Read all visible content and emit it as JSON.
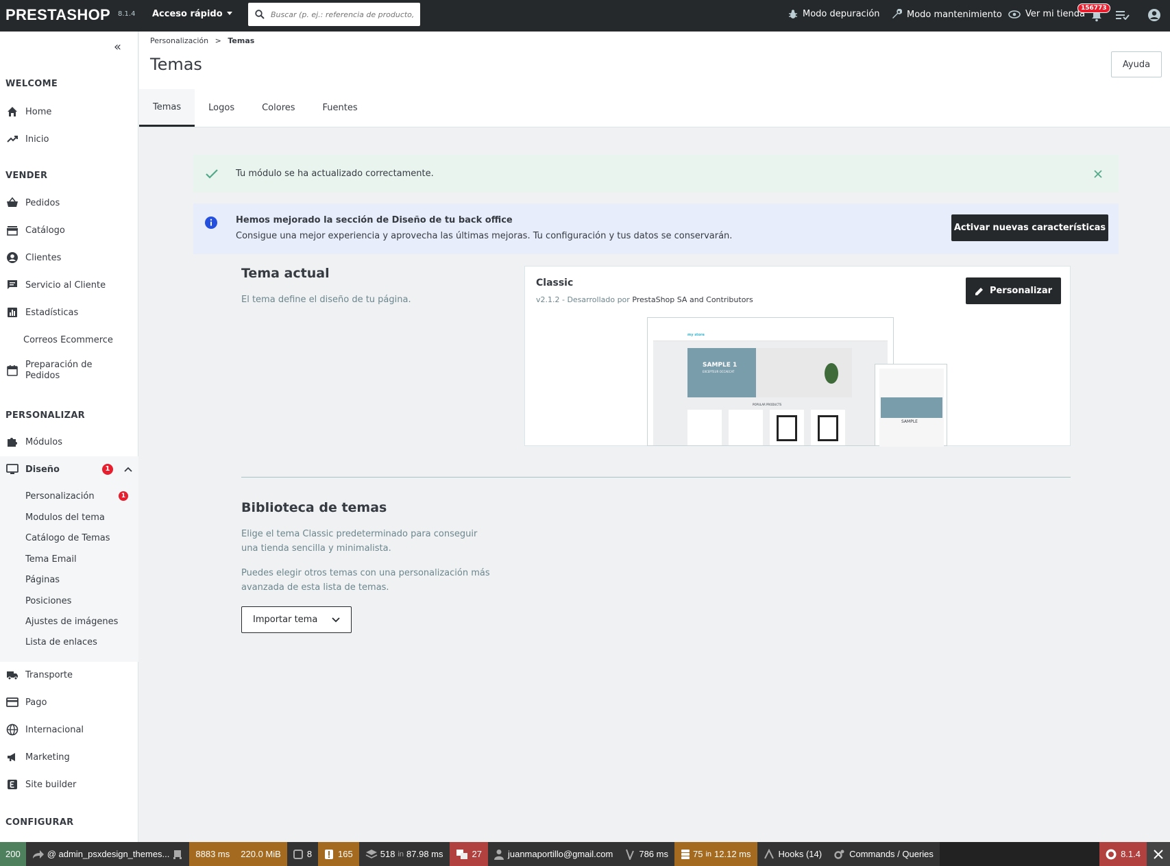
{
  "topbar": {
    "logo": "PRESTASHOP",
    "version": "8.1.4",
    "quick_access": "Acceso rápido",
    "search_placeholder": "Buscar (p. ej.: referencia de producto,",
    "debug": "Modo depuración",
    "maintenance": "Modo mantenimiento",
    "view_store": "Ver mi tienda",
    "notifications_count": "156773"
  },
  "sidebar": {
    "sections": {
      "welcome": "WELCOME",
      "sell": "VENDER",
      "customize": "PERSONALIZAR",
      "configure": "CONFIGURAR"
    },
    "welcome_items": [
      {
        "label": "Home",
        "icon": "home-icon"
      },
      {
        "label": "Inicio",
        "icon": "trending-up-icon"
      }
    ],
    "sell_items": [
      {
        "label": "Pedidos",
        "icon": "basket-icon"
      },
      {
        "label": "Catálogo",
        "icon": "store-icon"
      },
      {
        "label": "Clientes",
        "icon": "account-icon"
      },
      {
        "label": "Servicio al Cliente",
        "icon": "chat-icon"
      },
      {
        "label": "Estadísticas",
        "icon": "chart-icon"
      },
      {
        "label": "Correos Ecommerce",
        "icon": ""
      },
      {
        "label": "Preparación de Pedidos",
        "icon": "calendar-icon"
      }
    ],
    "modules": "Módulos",
    "design": "Diseño",
    "design_badge": "1",
    "design_sub": [
      {
        "label": "Personalización",
        "badge": "1"
      },
      {
        "label": "Modulos del tema"
      },
      {
        "label": "Catálogo de Temas"
      },
      {
        "label": "Tema Email"
      },
      {
        "label": "Páginas"
      },
      {
        "label": "Posiciones"
      },
      {
        "label": "Ajustes de imágenes"
      },
      {
        "label": "Lista de enlaces"
      }
    ],
    "more_items": [
      {
        "label": "Transporte",
        "icon": "truck-icon"
      },
      {
        "label": "Pago",
        "icon": "credit-card-icon"
      },
      {
        "label": "Internacional",
        "icon": "globe-icon"
      },
      {
        "label": "Marketing",
        "icon": "megaphone-icon"
      },
      {
        "label": "Site builder",
        "icon": "site-builder-icon"
      }
    ]
  },
  "header": {
    "breadcrumb_parent": "Personalización",
    "breadcrumb_sep": ">",
    "breadcrumb_current": "Temas",
    "title": "Temas",
    "help": "Ayuda",
    "tabs": [
      "Temas",
      "Logos",
      "Colores",
      "Fuentes"
    ]
  },
  "alerts": {
    "success": "Tu módulo se ha actualizado correctamente.",
    "info_title": "Hemos mejorado la sección de Diseño de tu back office",
    "info_text": "Consigue una mejor experiencia y aprovecha las últimas mejoras. Tu configuración y tus datos se conservarán.",
    "info_button": "Activar nuevas características"
  },
  "current_theme": {
    "heading": "Tema actual",
    "desc": "El tema define el diseño de tu página.",
    "name": "Classic",
    "meta_prefix": "v2.1.2 - Desarrollado por",
    "author": "PrestaShop SA and Contributors",
    "customize": "Personalizar",
    "preview": {
      "slide_title": "SAMPLE 1",
      "slide_sub": "EXCEPTEUR OCCAECAT",
      "popular": "POPULAR PRODUCTS",
      "mobile_title": "SAMPLE",
      "brand": "my store"
    }
  },
  "library": {
    "heading": "Biblioteca de temas",
    "p1": "Elige el tema Classic predeterminado para conseguir una tienda sencilla y minimalista.",
    "p2": "Puedes elegir otros temas con una personalización más avanzada de esta lista de temas.",
    "import": "Importar tema"
  },
  "profiler": {
    "status": "200",
    "route": "@ admin_psxdesign_themes...",
    "time": "8883 ms",
    "memory": "220.0 MiB",
    "forms": "8",
    "logs": "165",
    "cache": "518",
    "cache_in": "in",
    "cache_time": "87.98 ms",
    "translations": "27",
    "user": "juanmaportillo@gmail.com",
    "twig": "786 ms",
    "db": "75",
    "db_in": "in",
    "db_time": "12.12 ms",
    "hooks": "Hooks (14)",
    "commands": "Commands / Queries",
    "sf_version": "8.1.4"
  }
}
